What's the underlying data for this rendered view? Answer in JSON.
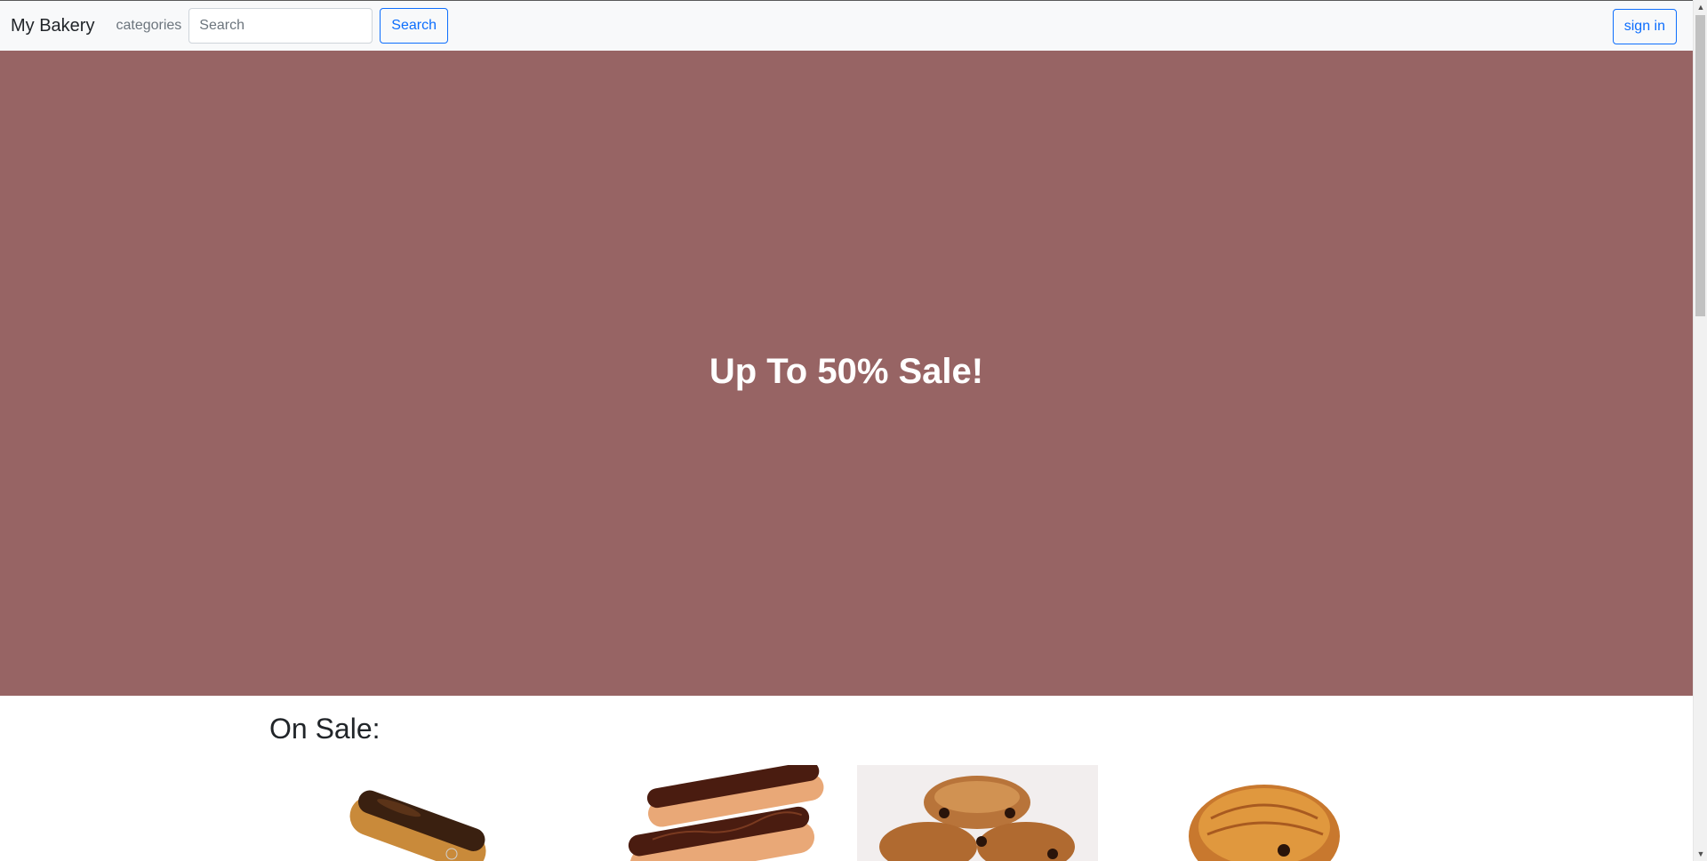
{
  "navbar": {
    "brand": "My Bakery",
    "categories": "categories",
    "search_placeholder": "Search",
    "search_button": "Search",
    "signin_button": "sign in"
  },
  "hero": {
    "title": "Up To 50% Sale!",
    "background_color": "#976464"
  },
  "sale_section": {
    "heading": "On Sale:",
    "products": [
      {
        "image": "eclair-image"
      },
      {
        "image": "chocolate-eclairs-image"
      },
      {
        "image": "pain-au-chocolat-stack-image"
      },
      {
        "image": "chocolate-croissant-image"
      }
    ]
  },
  "scrollbar": {
    "up_icon": "arrow-up-icon",
    "down_icon": "arrow-down-icon"
  },
  "colors": {
    "accent": "#0d6efd",
    "navbar_bg": "#f8f9fa"
  }
}
